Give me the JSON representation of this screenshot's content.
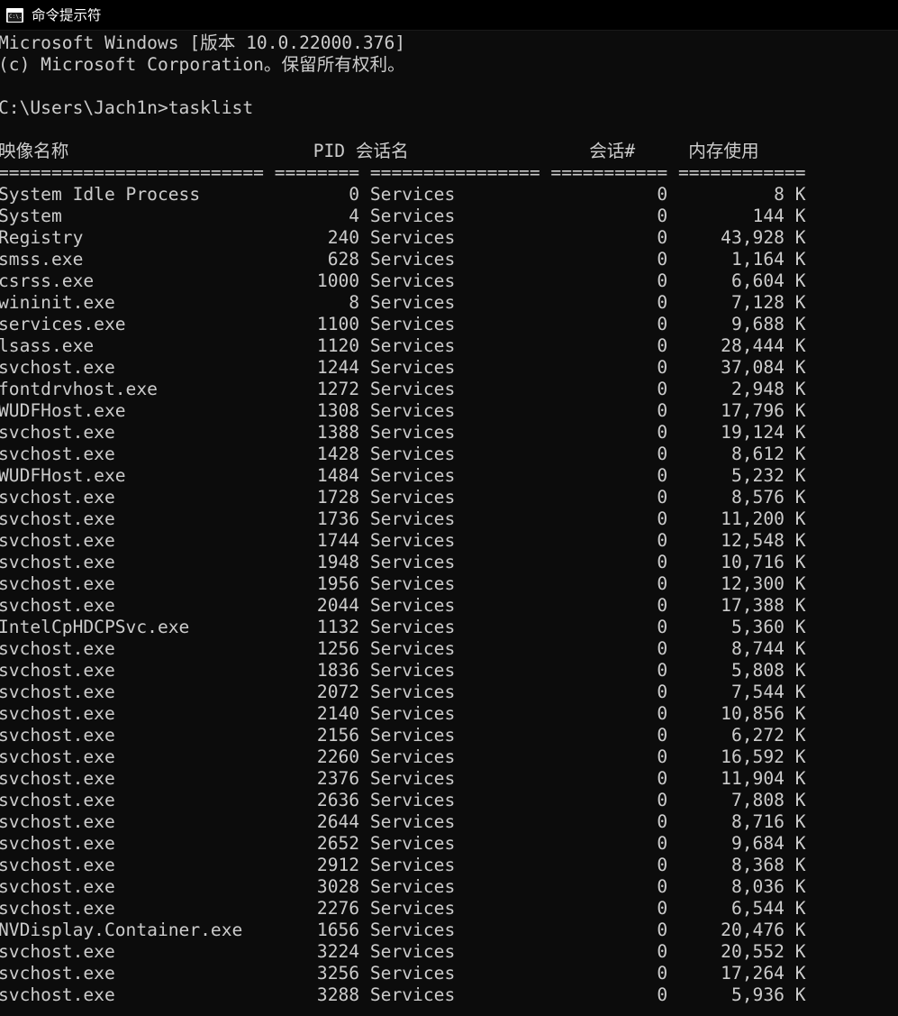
{
  "window": {
    "title": "命令提示符",
    "icon": "cmd-icon",
    "icon_glyph": "C:\\."
  },
  "terminal": {
    "background_color": "#0c0c0c",
    "foreground_color": "#cccccc",
    "banner": [
      "Microsoft Windows [版本 10.0.22000.376]",
      "(c) Microsoft Corporation。保留所有权利。"
    ],
    "prompt": "C:\\Users\\Jach1n>",
    "command": "tasklist",
    "columns": {
      "image_name": "映像名称",
      "pid": "PID",
      "session_name": "会话名",
      "session_number": "会话#",
      "memory_usage": "内存使用"
    },
    "separator": {
      "image_name": "========================= ",
      "pid": "======== ",
      "session_name": "================ ",
      "session_number": "=========== ",
      "memory_usage": "============"
    },
    "rows": [
      {
        "image_name": "System Idle Process",
        "pid": "0",
        "session_name": "Services",
        "session_number": "0",
        "memory_usage": "8 K"
      },
      {
        "image_name": "System",
        "pid": "4",
        "session_name": "Services",
        "session_number": "0",
        "memory_usage": "144 K"
      },
      {
        "image_name": "Registry",
        "pid": "240",
        "session_name": "Services",
        "session_number": "0",
        "memory_usage": "43,928 K"
      },
      {
        "image_name": "smss.exe",
        "pid": "628",
        "session_name": "Services",
        "session_number": "0",
        "memory_usage": "1,164 K"
      },
      {
        "image_name": "csrss.exe",
        "pid": "1000",
        "session_name": "Services",
        "session_number": "0",
        "memory_usage": "6,604 K"
      },
      {
        "image_name": "wininit.exe",
        "pid": "8",
        "session_name": "Services",
        "session_number": "0",
        "memory_usage": "7,128 K"
      },
      {
        "image_name": "services.exe",
        "pid": "1100",
        "session_name": "Services",
        "session_number": "0",
        "memory_usage": "9,688 K"
      },
      {
        "image_name": "lsass.exe",
        "pid": "1120",
        "session_name": "Services",
        "session_number": "0",
        "memory_usage": "28,444 K"
      },
      {
        "image_name": "svchost.exe",
        "pid": "1244",
        "session_name": "Services",
        "session_number": "0",
        "memory_usage": "37,084 K"
      },
      {
        "image_name": "fontdrvhost.exe",
        "pid": "1272",
        "session_name": "Services",
        "session_number": "0",
        "memory_usage": "2,948 K"
      },
      {
        "image_name": "WUDFHost.exe",
        "pid": "1308",
        "session_name": "Services",
        "session_number": "0",
        "memory_usage": "17,796 K"
      },
      {
        "image_name": "svchost.exe",
        "pid": "1388",
        "session_name": "Services",
        "session_number": "0",
        "memory_usage": "19,124 K"
      },
      {
        "image_name": "svchost.exe",
        "pid": "1428",
        "session_name": "Services",
        "session_number": "0",
        "memory_usage": "8,612 K"
      },
      {
        "image_name": "WUDFHost.exe",
        "pid": "1484",
        "session_name": "Services",
        "session_number": "0",
        "memory_usage": "5,232 K"
      },
      {
        "image_name": "svchost.exe",
        "pid": "1728",
        "session_name": "Services",
        "session_number": "0",
        "memory_usage": "8,576 K"
      },
      {
        "image_name": "svchost.exe",
        "pid": "1736",
        "session_name": "Services",
        "session_number": "0",
        "memory_usage": "11,200 K"
      },
      {
        "image_name": "svchost.exe",
        "pid": "1744",
        "session_name": "Services",
        "session_number": "0",
        "memory_usage": "12,548 K"
      },
      {
        "image_name": "svchost.exe",
        "pid": "1948",
        "session_name": "Services",
        "session_number": "0",
        "memory_usage": "10,716 K"
      },
      {
        "image_name": "svchost.exe",
        "pid": "1956",
        "session_name": "Services",
        "session_number": "0",
        "memory_usage": "12,300 K"
      },
      {
        "image_name": "svchost.exe",
        "pid": "2044",
        "session_name": "Services",
        "session_number": "0",
        "memory_usage": "17,388 K"
      },
      {
        "image_name": "IntelCpHDCPSvc.exe",
        "pid": "1132",
        "session_name": "Services",
        "session_number": "0",
        "memory_usage": "5,360 K"
      },
      {
        "image_name": "svchost.exe",
        "pid": "1256",
        "session_name": "Services",
        "session_number": "0",
        "memory_usage": "8,744 K"
      },
      {
        "image_name": "svchost.exe",
        "pid": "1836",
        "session_name": "Services",
        "session_number": "0",
        "memory_usage": "5,808 K"
      },
      {
        "image_name": "svchost.exe",
        "pid": "2072",
        "session_name": "Services",
        "session_number": "0",
        "memory_usage": "7,544 K"
      },
      {
        "image_name": "svchost.exe",
        "pid": "2140",
        "session_name": "Services",
        "session_number": "0",
        "memory_usage": "10,856 K"
      },
      {
        "image_name": "svchost.exe",
        "pid": "2156",
        "session_name": "Services",
        "session_number": "0",
        "memory_usage": "6,272 K"
      },
      {
        "image_name": "svchost.exe",
        "pid": "2260",
        "session_name": "Services",
        "session_number": "0",
        "memory_usage": "16,592 K"
      },
      {
        "image_name": "svchost.exe",
        "pid": "2376",
        "session_name": "Services",
        "session_number": "0",
        "memory_usage": "11,904 K"
      },
      {
        "image_name": "svchost.exe",
        "pid": "2636",
        "session_name": "Services",
        "session_number": "0",
        "memory_usage": "7,808 K"
      },
      {
        "image_name": "svchost.exe",
        "pid": "2644",
        "session_name": "Services",
        "session_number": "0",
        "memory_usage": "8,716 K"
      },
      {
        "image_name": "svchost.exe",
        "pid": "2652",
        "session_name": "Services",
        "session_number": "0",
        "memory_usage": "9,684 K"
      },
      {
        "image_name": "svchost.exe",
        "pid": "2912",
        "session_name": "Services",
        "session_number": "0",
        "memory_usage": "8,368 K"
      },
      {
        "image_name": "svchost.exe",
        "pid": "3028",
        "session_name": "Services",
        "session_number": "0",
        "memory_usage": "8,036 K"
      },
      {
        "image_name": "svchost.exe",
        "pid": "2276",
        "session_name": "Services",
        "session_number": "0",
        "memory_usage": "6,544 K"
      },
      {
        "image_name": "NVDisplay.Container.exe",
        "pid": "1656",
        "session_name": "Services",
        "session_number": "0",
        "memory_usage": "20,476 K"
      },
      {
        "image_name": "svchost.exe",
        "pid": "3224",
        "session_name": "Services",
        "session_number": "0",
        "memory_usage": "20,552 K"
      },
      {
        "image_name": "svchost.exe",
        "pid": "3256",
        "session_name": "Services",
        "session_number": "0",
        "memory_usage": "17,264 K"
      },
      {
        "image_name": "svchost.exe",
        "pid": "3288",
        "session_name": "Services",
        "session_number": "0",
        "memory_usage": "5,936 K"
      }
    ]
  }
}
